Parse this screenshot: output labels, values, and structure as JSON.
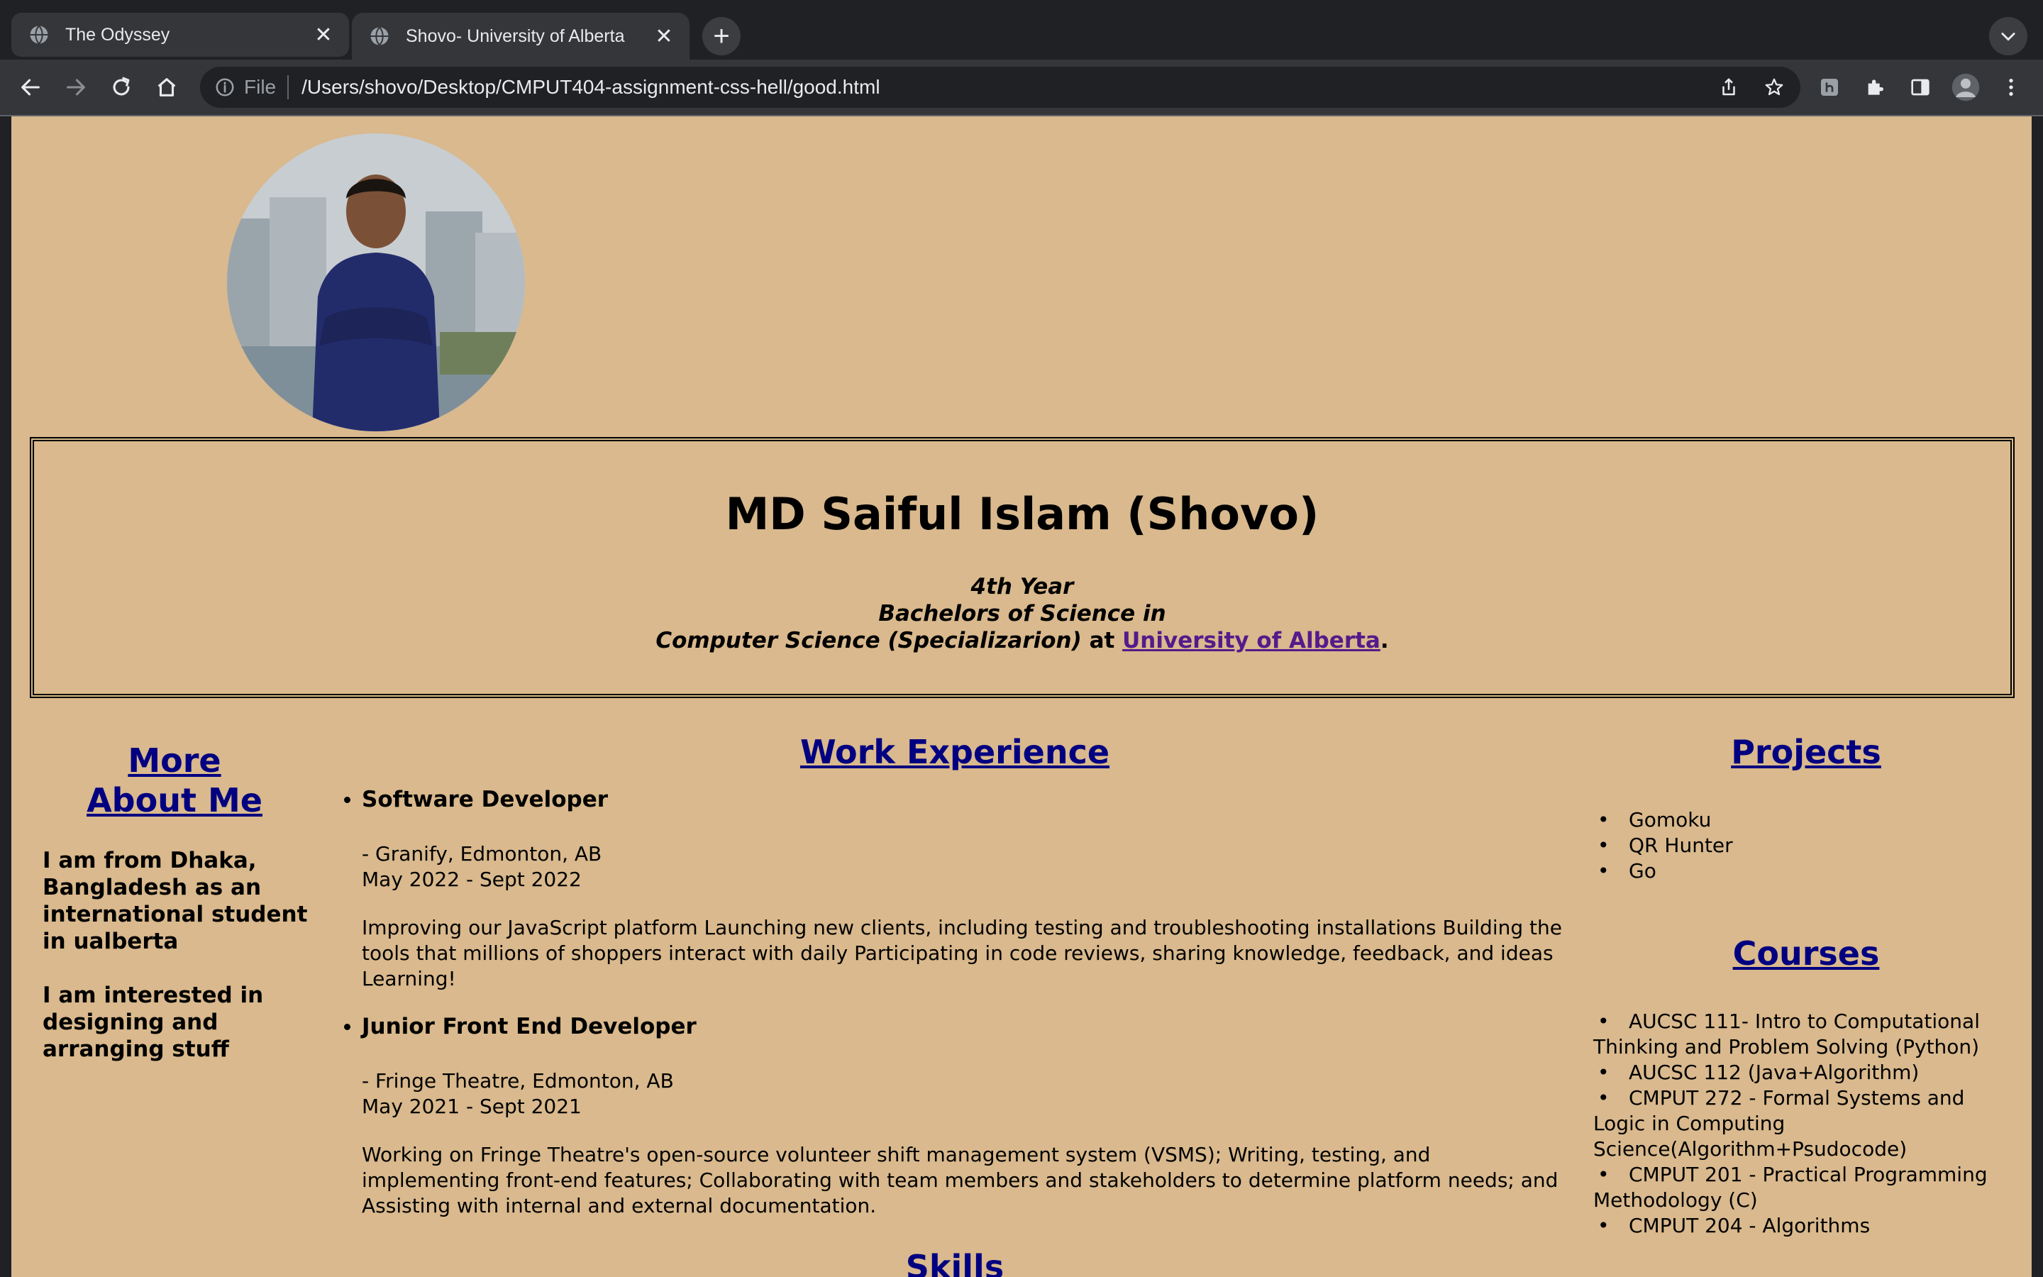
{
  "browser": {
    "tabs": [
      {
        "title": "The Odyssey",
        "active": false
      },
      {
        "title": "Shovo- University of Alberta",
        "active": true
      }
    ],
    "omnibox": {
      "scheme": "File",
      "url": "/Users/shovo/Desktop/CMPUT404-assignment-css-hell/good.html"
    }
  },
  "header": {
    "name": "MD Saiful Islam (Shovo)",
    "line1": "4th Year",
    "line2": "Bachelors of Science in",
    "line3": "Computer Science (Specializarion)",
    "at": " at ",
    "university_link": "University of Alberta",
    "period": "."
  },
  "about": {
    "heading_line1": "More",
    "heading_line2": "About Me",
    "para1": "I am from Dhaka, Bangladesh as an international student in ualberta",
    "para2": "I am interested in designing and arranging stuff"
  },
  "work": {
    "heading": "Work Experience",
    "jobs": [
      {
        "title": "Software Developer",
        "company": "- Granify, Edmonton, AB",
        "dates": "May 2022 - Sept 2022",
        "description": "Improving our JavaScript platform Launching new clients, including testing and troubleshooting installations Building the tools that millions of shoppers interact with daily Participating in code reviews, sharing knowledge, feedback, and ideas Learning!"
      },
      {
        "title": "Junior Front End Developer",
        "company": "- Fringe Theatre, Edmonton, AB",
        "dates": "May 2021 - Sept 2021",
        "description": "Working on Fringe Theatre's open-source volunteer shift management system (VSMS); Writing, testing, and implementing front-end features; Collaborating with team members and stakeholders to determine platform needs; and Assisting with internal and external documentation."
      }
    ],
    "skills_heading": "Skills"
  },
  "projects": {
    "heading": "Projects",
    "items": [
      "Gomoku",
      "QR Hunter",
      "Go"
    ]
  },
  "courses": {
    "heading": "Courses",
    "items": [
      "AUCSC 111- Intro to Computational Thinking and Problem Solving (Python)",
      "AUCSC 112 (Java+Algorithm)",
      "CMPUT 272 - Formal Systems and Logic in Computing Science(Algorithm+Psudocode)",
      "CMPUT 201 - Practical Programming Methodology (C)",
      "CMPUT 204 - Algorithms"
    ]
  }
}
